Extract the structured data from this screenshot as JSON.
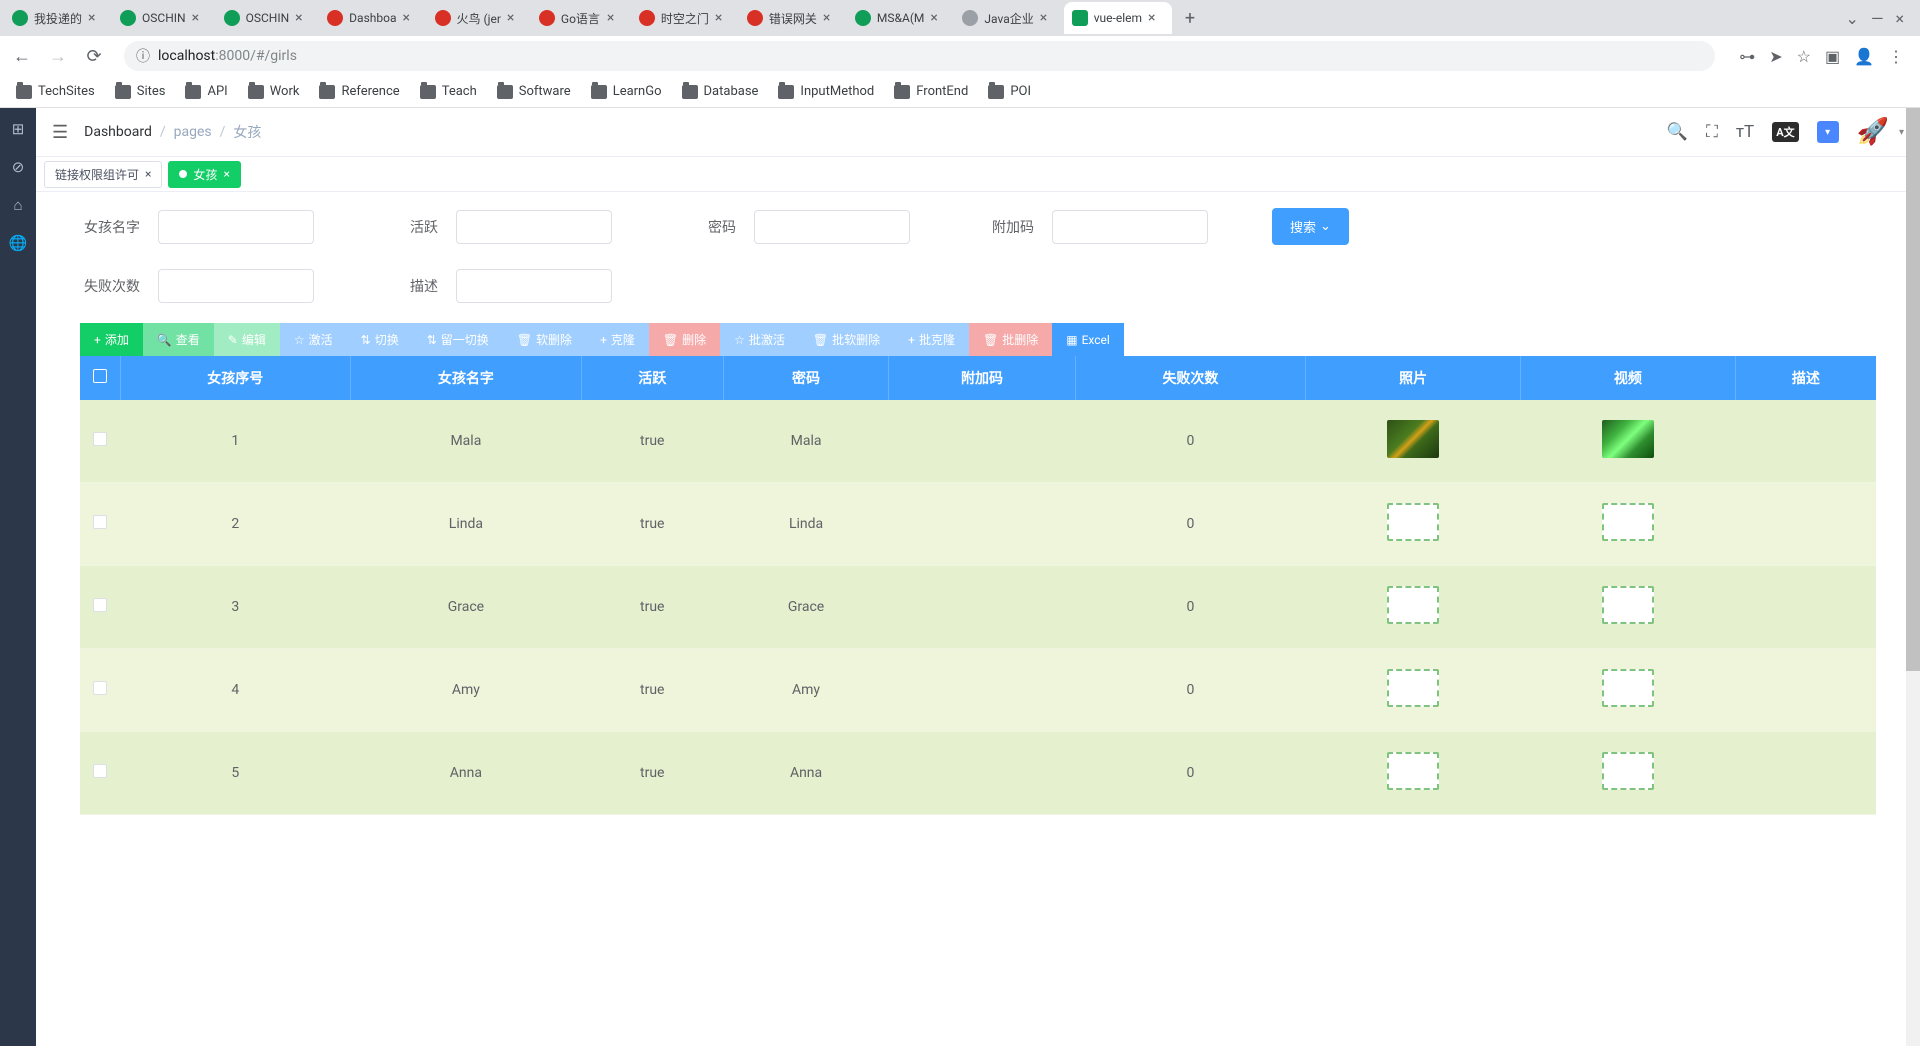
{
  "browser": {
    "tabs": [
      {
        "title": "我投递的",
        "favicon": "green"
      },
      {
        "title": "OSCHIN",
        "favicon": "green"
      },
      {
        "title": "OSCHIN",
        "favicon": "green"
      },
      {
        "title": "Dashboa",
        "favicon": "red"
      },
      {
        "title": "火鸟 (jer",
        "favicon": "red"
      },
      {
        "title": "Go语言",
        "favicon": "red"
      },
      {
        "title": "时空之门",
        "favicon": "red"
      },
      {
        "title": "错误网关",
        "favicon": "red"
      },
      {
        "title": "MS&A(M",
        "favicon": "green"
      },
      {
        "title": "Java企业",
        "favicon": "gray"
      },
      {
        "title": "vue-elem",
        "favicon": "active",
        "active": true
      }
    ],
    "url_host": "localhost",
    "url_port_path": ":8000/#/girls",
    "bookmarks": [
      "TechSites",
      "Sites",
      "API",
      "Work",
      "Reference",
      "Teach",
      "Software",
      "LearnGo",
      "Database",
      "InputMethod",
      "FrontEnd",
      "POI"
    ]
  },
  "header": {
    "breadcrumb": [
      "Dashboard",
      "pages",
      "女孩"
    ],
    "lang_badge": "A文"
  },
  "page_tabs": [
    {
      "label": "链接权限组许可",
      "active": false
    },
    {
      "label": "女孩",
      "active": true
    }
  ],
  "search": {
    "fields": [
      {
        "label": "女孩名字"
      },
      {
        "label": "活跃"
      },
      {
        "label": "密码"
      },
      {
        "label": "附加码"
      }
    ],
    "fields_row2": [
      {
        "label": "失败次数"
      },
      {
        "label": "描述"
      }
    ],
    "button": "搜索"
  },
  "actions": [
    {
      "label": "添加",
      "icon": "+",
      "cls": "btn-green"
    },
    {
      "label": "查看",
      "icon": "🔍",
      "cls": "btn-green-l"
    },
    {
      "label": "编辑",
      "icon": "✎",
      "cls": "btn-green-ll"
    },
    {
      "label": "激活",
      "icon": "☆",
      "cls": "btn-blue-l"
    },
    {
      "label": "切换",
      "icon": "⇅",
      "cls": "btn-blue-l"
    },
    {
      "label": "留一切换",
      "icon": "⇅",
      "cls": "btn-blue-l"
    },
    {
      "label": "软删除",
      "icon": "🗑",
      "cls": "btn-blue-l"
    },
    {
      "label": "克隆",
      "icon": "+",
      "cls": "btn-blue-l"
    },
    {
      "label": "删除",
      "icon": "🗑",
      "cls": "btn-red-l"
    },
    {
      "label": "批激活",
      "icon": "☆",
      "cls": "btn-blue-l"
    },
    {
      "label": "批软删除",
      "icon": "🗑",
      "cls": "btn-blue-l"
    },
    {
      "label": "批克隆",
      "icon": "+",
      "cls": "btn-blue-l"
    },
    {
      "label": "批删除",
      "icon": "🗑",
      "cls": "btn-red-l"
    },
    {
      "label": "Excel",
      "icon": "▦",
      "cls": "btn-blue"
    }
  ],
  "table": {
    "columns": [
      "",
      "女孩序号",
      "女孩名字",
      "活跃",
      "密码",
      "附加码",
      "失败次数",
      "照片",
      "视频",
      "描述"
    ],
    "rows": [
      {
        "id": "1",
        "name": "Mala",
        "active": "true",
        "pwd": "Mala",
        "extra": "",
        "fail": "0",
        "photo": "img1",
        "video": "img2",
        "desc": ""
      },
      {
        "id": "2",
        "name": "Linda",
        "active": "true",
        "pwd": "Linda",
        "extra": "",
        "fail": "0",
        "photo": "frame",
        "video": "frame",
        "desc": ""
      },
      {
        "id": "3",
        "name": "Grace",
        "active": "true",
        "pwd": "Grace",
        "extra": "",
        "fail": "0",
        "photo": "frame",
        "video": "frame",
        "desc": ""
      },
      {
        "id": "4",
        "name": "Amy",
        "active": "true",
        "pwd": "Amy",
        "extra": "",
        "fail": "0",
        "photo": "frame",
        "video": "frame",
        "desc": ""
      },
      {
        "id": "5",
        "name": "Anna",
        "active": "true",
        "pwd": "Anna",
        "extra": "",
        "fail": "0",
        "photo": "frame",
        "video": "frame",
        "desc": ""
      }
    ]
  }
}
